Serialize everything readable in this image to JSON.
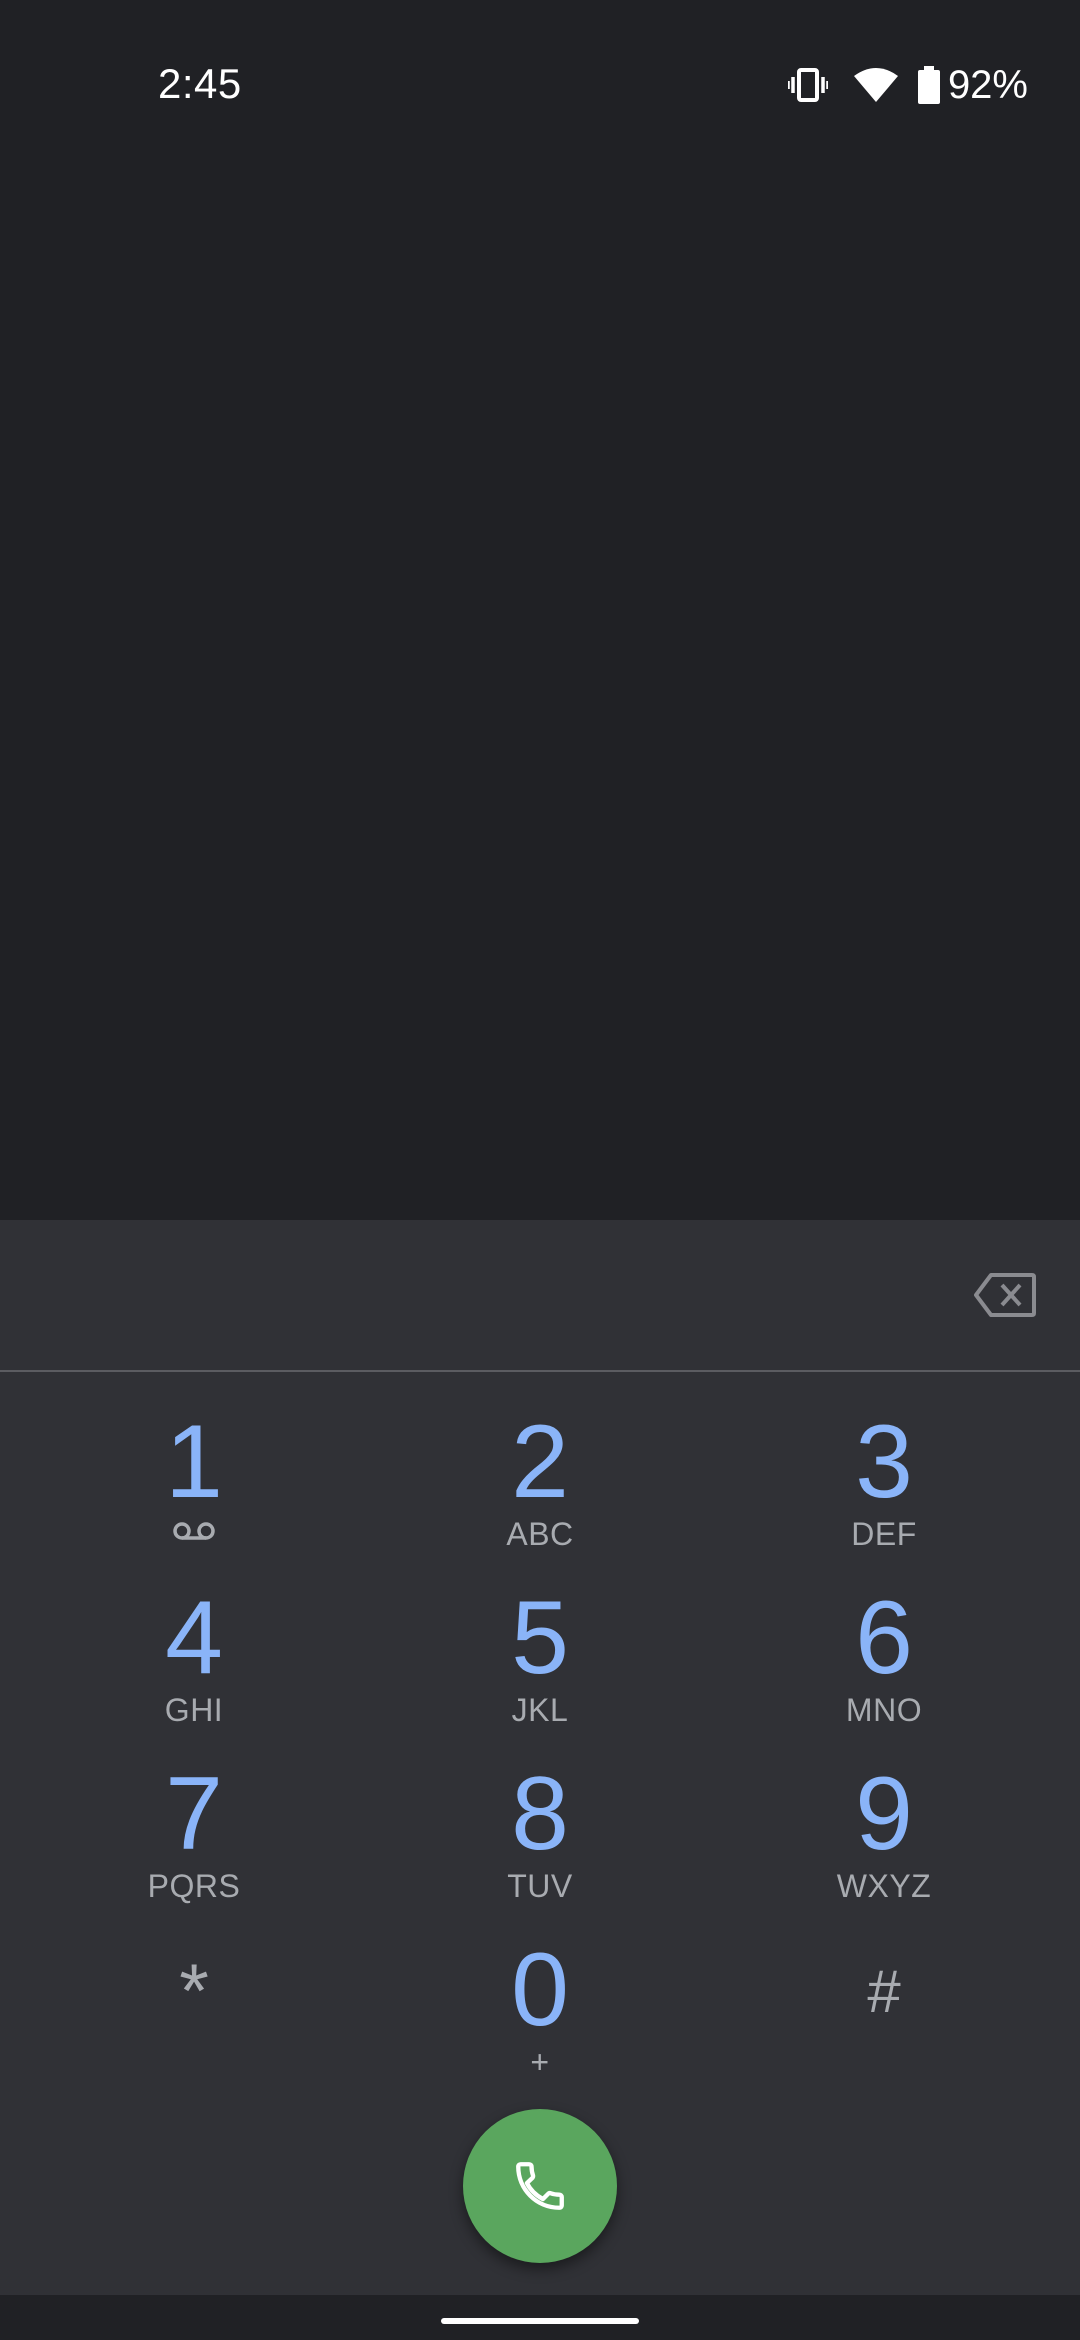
{
  "status_bar": {
    "time": "2:45",
    "battery_percent": "92%",
    "icons": [
      "vibrate-icon",
      "wifi-icon",
      "battery-icon"
    ]
  },
  "dialpad": {
    "entered_digits": "",
    "keys": [
      {
        "digit": "1",
        "letters": "",
        "icon": "voicemail-icon"
      },
      {
        "digit": "2",
        "letters": "ABC"
      },
      {
        "digit": "3",
        "letters": "DEF"
      },
      {
        "digit": "4",
        "letters": "GHI"
      },
      {
        "digit": "5",
        "letters": "JKL"
      },
      {
        "digit": "6",
        "letters": "MNO"
      },
      {
        "digit": "7",
        "letters": "PQRS"
      },
      {
        "digit": "8",
        "letters": "TUV"
      },
      {
        "digit": "9",
        "letters": "WXYZ"
      },
      {
        "digit": "*",
        "letters": ""
      },
      {
        "digit": "0",
        "letters": "+"
      },
      {
        "digit": "#",
        "letters": ""
      }
    ],
    "backspace_icon": "backspace-icon",
    "call_icon": "phone-icon"
  },
  "colors": {
    "background": "#202125",
    "panel": "#303136",
    "digit_accent": "#8ab4f8",
    "call_button": "#5aa65e"
  }
}
